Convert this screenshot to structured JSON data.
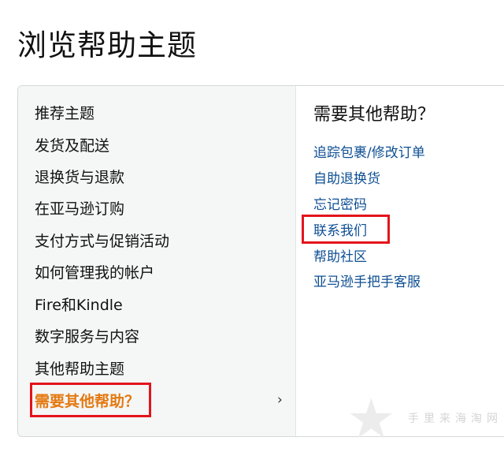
{
  "page": {
    "title": "浏览帮助主题"
  },
  "nav": {
    "items": [
      {
        "label": "推荐主题"
      },
      {
        "label": "发货及配送"
      },
      {
        "label": "退换货与退款"
      },
      {
        "label": "在亚马逊订购"
      },
      {
        "label": "支付方式与促销活动"
      },
      {
        "label": "如何管理我的帐户"
      },
      {
        "label": "Fire和Kindle"
      },
      {
        "label": "数字服务与内容"
      },
      {
        "label": "其他帮助主题"
      },
      {
        "label": "需要其他帮助？",
        "chevron": "›"
      }
    ],
    "active_index": 9,
    "active_color": "#e47911"
  },
  "right": {
    "heading": "需要其他帮助？",
    "links": [
      {
        "label": "追踪包裹/修改订单"
      },
      {
        "label": "自助退换货"
      },
      {
        "label": "忘记密码"
      },
      {
        "label": "联系我们"
      },
      {
        "label": "帮助社区"
      },
      {
        "label": "亚马逊手把手客服"
      }
    ],
    "link_color": "#0e4f94"
  },
  "highlight_color": "#e4141b",
  "watermark": {
    "text": "手里来海淘网",
    "icon": "star-icon"
  }
}
